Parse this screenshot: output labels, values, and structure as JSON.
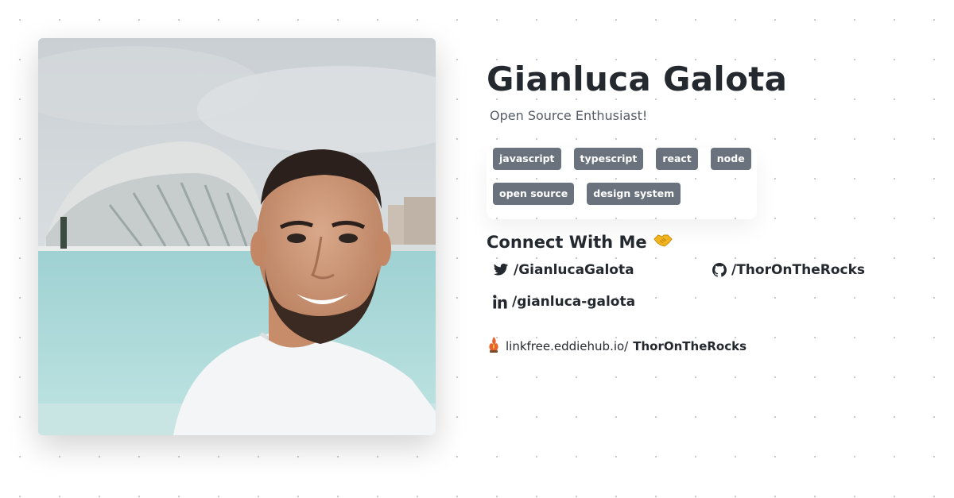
{
  "profile": {
    "name": "Gianluca Galota",
    "bio": "Open Source Enthusiast!",
    "photo_alt": "profile-photo"
  },
  "tags": {
    "row1": [
      "javascript",
      "typescript",
      "react",
      "node"
    ],
    "row2": [
      "open source",
      "design system"
    ]
  },
  "connect": {
    "title": "Connect With Me",
    "icon": "handshake-icon"
  },
  "socials": {
    "twitter": {
      "label": "/GianlucaGalota",
      "icon": "twitter-icon"
    },
    "github": {
      "label": "/ThorOnTheRocks",
      "icon": "github-icon"
    },
    "linkedin": {
      "label": "/gianluca-galota",
      "icon": "linkedin-icon"
    }
  },
  "linkfree": {
    "icon": "linkfree-logo",
    "domain": "linkfree.eddiehub.io/",
    "username": "ThorOnTheRocks"
  },
  "colors": {
    "tag_bg": "#6a737d",
    "text_dark": "#24292f",
    "text_muted": "#555c66",
    "handshake": "#f2b51f"
  }
}
